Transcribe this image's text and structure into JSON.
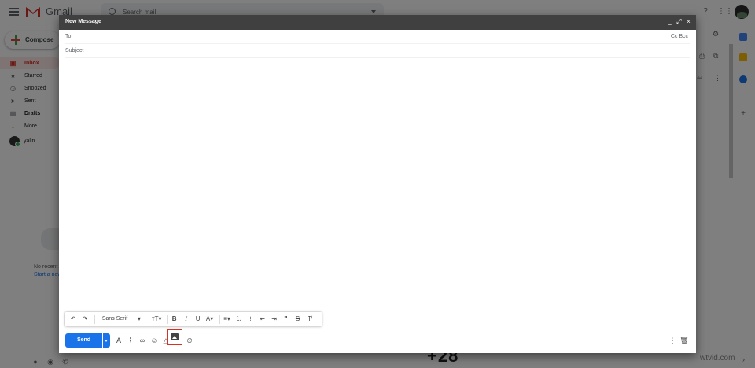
{
  "app": {
    "name": "Gmail"
  },
  "search": {
    "placeholder": "Search mail"
  },
  "sidebar": {
    "compose_label": "Compose",
    "items": [
      {
        "label": "Inbox",
        "icon": "inbox-icon",
        "active": true
      },
      {
        "label": "Starred",
        "icon": "star-icon"
      },
      {
        "label": "Snoozed",
        "icon": "clock-icon"
      },
      {
        "label": "Sent",
        "icon": "send-icon"
      },
      {
        "label": "Drafts",
        "icon": "draft-icon",
        "bold": true
      },
      {
        "label": "More",
        "icon": "chevron-down-icon"
      }
    ],
    "user": "yalin"
  },
  "hangouts": {
    "no_recent": "No recent c",
    "start_new": "Start a new"
  },
  "compose": {
    "title": "New Message",
    "to_label": "To",
    "cc_bcc": "Cc Bcc",
    "subject_label": "Subject",
    "font": "Sans Serif",
    "send_label": "Send"
  },
  "overlay_text": {
    "number": "+28",
    "site": "wtvid.com"
  },
  "colors": {
    "accent": "#1a73e8",
    "header": "#404040",
    "highlight": "#d93025"
  }
}
